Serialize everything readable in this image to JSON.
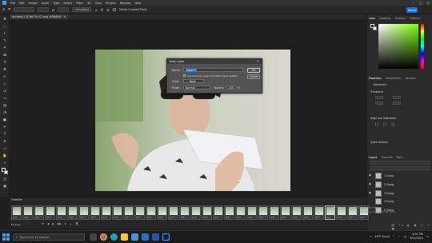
{
  "menubar": {
    "items": [
      "File",
      "Edit",
      "Image",
      "Layer",
      "Type",
      "Select",
      "Filter",
      "3D",
      "View",
      "Plugins",
      "Window",
      "Help"
    ]
  },
  "optionsbar": {
    "width_placeholder": "",
    "mode_value": "Unmodified",
    "delete_label": "Delete Cropped Pixels",
    "share_label": "Share"
  },
  "document": {
    "tab_title": "Untitled-1 @ 66.7% (Cl ong, RGB/8#)"
  },
  "dialog": {
    "title": "New Layer",
    "name_label": "Name:",
    "name_value": "Layer 1",
    "clip_label": "Use Previous Layer to Create Clipping Mask",
    "color_label": "Color:",
    "color_value": "None",
    "mode_label": "Mode:",
    "mode_value": "Normal",
    "opacity_label": "Opacity:",
    "opacity_value": "100",
    "opacity_unit": "%",
    "ok_label": "OK",
    "cancel_label": "Cancel"
  },
  "rightpanel": {
    "color_tabs": [
      "Color",
      "Swatches",
      "Gradient",
      "Patterns"
    ],
    "props_tabs": [
      "Properties",
      "Adjustments",
      "Libraries"
    ],
    "doc_label": "Document",
    "transform_label": "Transform",
    "align_label": "Align and Distribute",
    "quick_actions_label": "Quick Actions",
    "layers_tabs": [
      "Layers",
      "Channels",
      "Paths"
    ],
    "layers": [
      {
        "name": "1 Clong"
      },
      {
        "name": "2 Clong"
      },
      {
        "name": "3 Clong"
      },
      {
        "name": "4 Clong"
      },
      {
        "name": "5 Clong"
      }
    ]
  },
  "timeline": {
    "title": "Timeline",
    "loop_label": "Forever",
    "frames": [
      "0.07",
      "0.07",
      "0.07",
      "0.07",
      "0.07",
      "0.07",
      "0.07",
      "0.07",
      "0.07",
      "0.07",
      "0.07",
      "0.07",
      "0.07",
      "0.07",
      "0.07",
      "0.07",
      "0.07",
      "0.07",
      "0.07",
      "0.07",
      "0.07",
      "0.07",
      "0.07",
      "0.07",
      "0.07",
      "0.07",
      "0.07",
      "0.07",
      "0.07",
      "0.07",
      "0.07",
      "0.07"
    ]
  },
  "watermark": {
    "line1": "Activate Windows",
    "line2": "Go to Settings to activate Windows."
  },
  "taskbar": {
    "search_placeholder": "Type here to search",
    "weather": "29°F Sunny",
    "time": "6:51 PM",
    "date": "3/31/2023"
  },
  "colors": {
    "accent": "#1473e6",
    "ps_blue": "#31a8ff",
    "fg_color": "#000000",
    "bg_color": "#ffffff"
  }
}
